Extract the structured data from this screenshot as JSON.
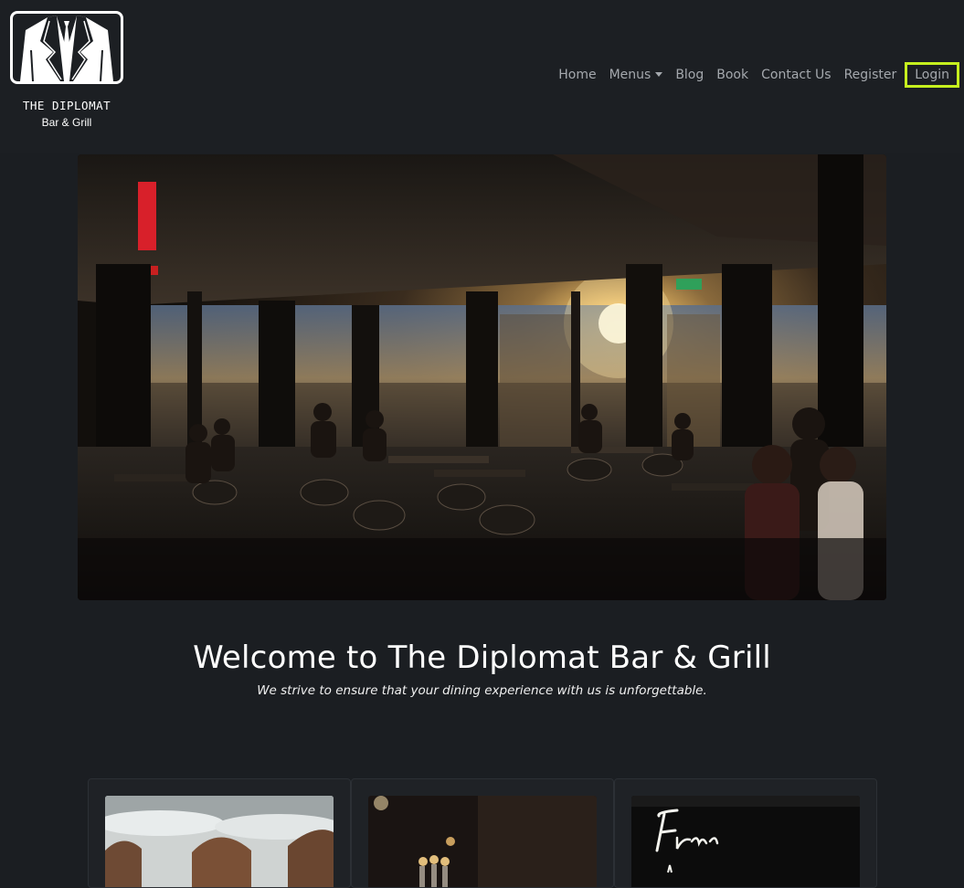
{
  "brand": {
    "name": "THE DIPLOMAT",
    "tagline": "Bar & Grill",
    "logo_icon": "suit-jacket-icon"
  },
  "nav": {
    "items": [
      {
        "label": "Home"
      },
      {
        "label": "Menus",
        "has_dropdown": true
      },
      {
        "label": "Blog"
      },
      {
        "label": "Book"
      },
      {
        "label": "Contact Us"
      },
      {
        "label": "Register"
      },
      {
        "label": "Login",
        "highlighted": true
      }
    ]
  },
  "hero": {
    "image": "restaurant-interior-sunset-photo"
  },
  "welcome": {
    "title": "Welcome to The Diplomat Bar & Grill",
    "subtitle": "We strive to ensure that your dining experience with us is unforgettable."
  },
  "cards": [
    {
      "image": "dining-tables-photo"
    },
    {
      "image": "candles-bar-photo"
    },
    {
      "image": "neon-sign-photo"
    }
  ],
  "colors": {
    "background": "#1b1e22",
    "nav_text": "#a4a8ad",
    "login_highlight": "#c6f01e",
    "text": "#ffffff"
  }
}
